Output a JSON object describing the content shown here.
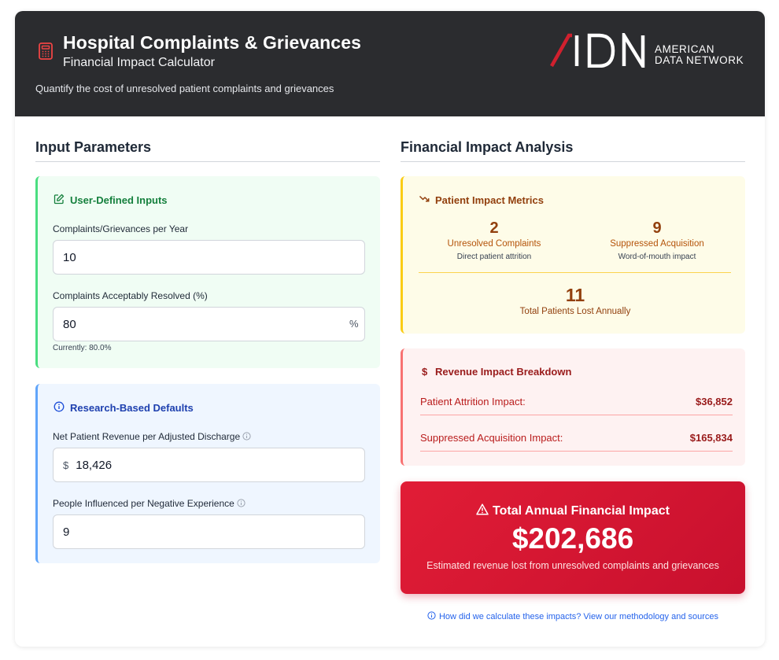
{
  "header": {
    "title": "Hospital Complaints & Grievances",
    "subtitle": "Financial Impact Calculator",
    "description": "Quantify the cost of unresolved patient complaints and grievances",
    "logo_letters": "ADN",
    "logo_line1": "AMERICAN",
    "logo_line2": "DATA NETWORK",
    "icon": "calculator-icon"
  },
  "colors": {
    "header_bg": "#2b2c2f",
    "brand_red": "#c8102e",
    "green_accent": "#4ade80",
    "blue_accent": "#60a5fa",
    "yellow_accent": "#facc15",
    "red_accent": "#f87171"
  },
  "inputs": {
    "section_title": "Input Parameters",
    "user_defined": {
      "title": "User-Defined Inputs",
      "icon": "edit-icon",
      "complaints_label": "Complaints/Grievances per Year",
      "complaints_value": "10",
      "resolved_label": "Complaints Acceptably Resolved (%)",
      "resolved_value": "80",
      "resolved_suffix": "%",
      "resolved_hint": "Currently: 80.0%"
    },
    "defaults": {
      "title": "Research-Based Defaults",
      "icon": "info-icon",
      "revenue_label": "Net Patient Revenue per Adjusted Discharge",
      "revenue_prefix": "$",
      "revenue_value": "18,426",
      "influenced_label": "People Influenced per Negative Experience",
      "influenced_value": "9"
    }
  },
  "analysis": {
    "section_title": "Financial Impact Analysis",
    "patient_metrics": {
      "title": "Patient Impact Metrics",
      "icon": "trending-down-icon",
      "unresolved_num": "2",
      "unresolved_label": "Unresolved Complaints",
      "unresolved_sub": "Direct patient attrition",
      "suppressed_num": "9",
      "suppressed_label": "Suppressed Acquisition",
      "suppressed_sub": "Word-of-mouth impact",
      "total_num": "11",
      "total_label": "Total Patients Lost Annually"
    },
    "revenue": {
      "title": "Revenue Impact Breakdown",
      "icon": "dollar-icon",
      "icon_glyph": "$",
      "rows": [
        {
          "label": "Patient Attrition Impact:",
          "value": "$36,852"
        },
        {
          "label": "Suppressed Acquisition Impact:",
          "value": "$165,834"
        }
      ]
    },
    "total": {
      "title": "Total Annual Financial Impact",
      "icon": "warning-icon",
      "value": "$202,686",
      "description": "Estimated revenue lost from unresolved complaints and grievances"
    },
    "methodology_link": "How did we calculate these impacts? View our methodology and sources"
  }
}
